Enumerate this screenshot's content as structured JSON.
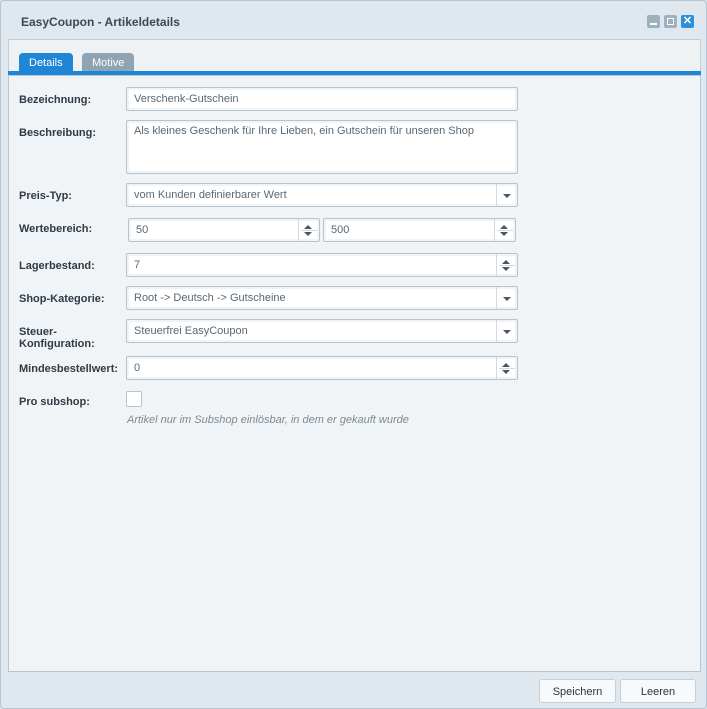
{
  "window": {
    "title": "EasyCoupon - Artikeldetails",
    "close_glyph": "✕"
  },
  "tabs": [
    {
      "label": "Details",
      "active": true
    },
    {
      "label": "Motive",
      "active": false
    }
  ],
  "form": {
    "bezeichnung": {
      "label": "Bezeichnung:",
      "value": "Verschenk-Gutschein"
    },
    "beschreibung": {
      "label": "Beschreibung:",
      "value": "Als kleines Geschenk für Ihre Lieben, ein Gutschein für unseren Shop"
    },
    "preis_typ": {
      "label": "Preis-Typ:",
      "value": "vom Kunden definierbarer Wert"
    },
    "wertebereich": {
      "label": "Wertebereich:",
      "min": "50",
      "max": "500"
    },
    "lagerbestand": {
      "label": "Lagerbestand:",
      "value": "7"
    },
    "shop_kategorie": {
      "label": "Shop-Kategorie:",
      "value": "Root -> Deutsch -> Gutscheine"
    },
    "steuer": {
      "label_line1": "Steuer-",
      "label_line2": "Konfiguration:",
      "value": "Steuerfrei EasyCoupon"
    },
    "mindestbestellwert": {
      "label": "Mindesbestellwert:",
      "value": "0"
    },
    "pro_subshop": {
      "label": "Pro subshop:",
      "checked": false,
      "hint": "Artikel nur im Subshop einlösbar, in dem er gekauft wurde"
    }
  },
  "footer": {
    "save_label": "Speichern",
    "clear_label": "Leeren"
  },
  "colors": {
    "accent": "#1e86d4",
    "inactive_tab": "#8fa4b2"
  }
}
